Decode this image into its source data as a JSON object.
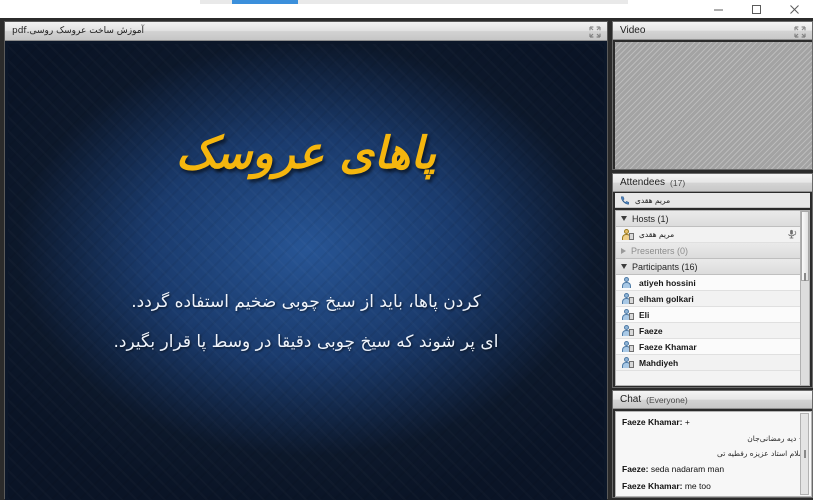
{
  "window": {
    "minimize_label": "minimize",
    "maximize_label": "maximize",
    "close_label": "close"
  },
  "document_pod": {
    "title": "آموزش ساخت عروسک روسی.pdf",
    "expand_label": "fullscreen"
  },
  "slide": {
    "title": "پاهای عروسک",
    "lines": [
      "کردن پاها، باید از سیخ چوبی ضخیم استفاده گردد.",
      "ای پر شوند که سیخ چوبی دقیقا در وسط پا قرار بگیرد."
    ],
    "bg_color": "#1c3f77",
    "title_color": "#f5b60e",
    "text_color": "#eef3fb"
  },
  "video_pod": {
    "title": "Video",
    "expand_label": "fullscreen"
  },
  "attendees_pod": {
    "title": "Attendees",
    "count": "(17)",
    "self_name": "مریم هقدی",
    "groups": [
      {
        "label": "Hosts (1)",
        "expanded": true,
        "muted": false
      },
      {
        "label": "Presenters (0)",
        "expanded": false,
        "muted": true
      },
      {
        "label": "Participants (16)",
        "expanded": true,
        "muted": false
      }
    ],
    "hosts": [
      {
        "name": "مریم هقدی",
        "rtl": true,
        "icon": "host-user-icon",
        "mic": true
      }
    ],
    "participants": [
      {
        "name": "atiyeh hossini",
        "rtl": false,
        "icon": "user-icon",
        "screen": false
      },
      {
        "name": "elham golkari",
        "rtl": false,
        "icon": "user-screen-icon",
        "screen": true
      },
      {
        "name": "Eli",
        "rtl": false,
        "icon": "user-screen-icon",
        "screen": true
      },
      {
        "name": "Faeze",
        "rtl": false,
        "icon": "user-screen-icon",
        "screen": true
      },
      {
        "name": "Faeze Khamar",
        "rtl": false,
        "icon": "user-screen-icon",
        "screen": true
      },
      {
        "name": "Mahdiyeh",
        "rtl": false,
        "icon": "user-screen-icon",
        "screen": true
      }
    ]
  },
  "chat_pod": {
    "title": "Chat",
    "scope": "(Everyone)",
    "messages": [
      {
        "sender": "Faeze Khamar:",
        "text": " +",
        "rtl": false
      },
      {
        "sender": "",
        "text": "+ دیه رمضانی‌جان",
        "rtl": true
      },
      {
        "sender": "",
        "text": "سلام استاد عزیزه رفطیه تی",
        "rtl": true
      },
      {
        "sender": "Faeze:",
        "text": " seda nadaram man",
        "rtl": false
      },
      {
        "sender": "Faeze Khamar:",
        "text": " me too",
        "rtl": false
      }
    ]
  }
}
